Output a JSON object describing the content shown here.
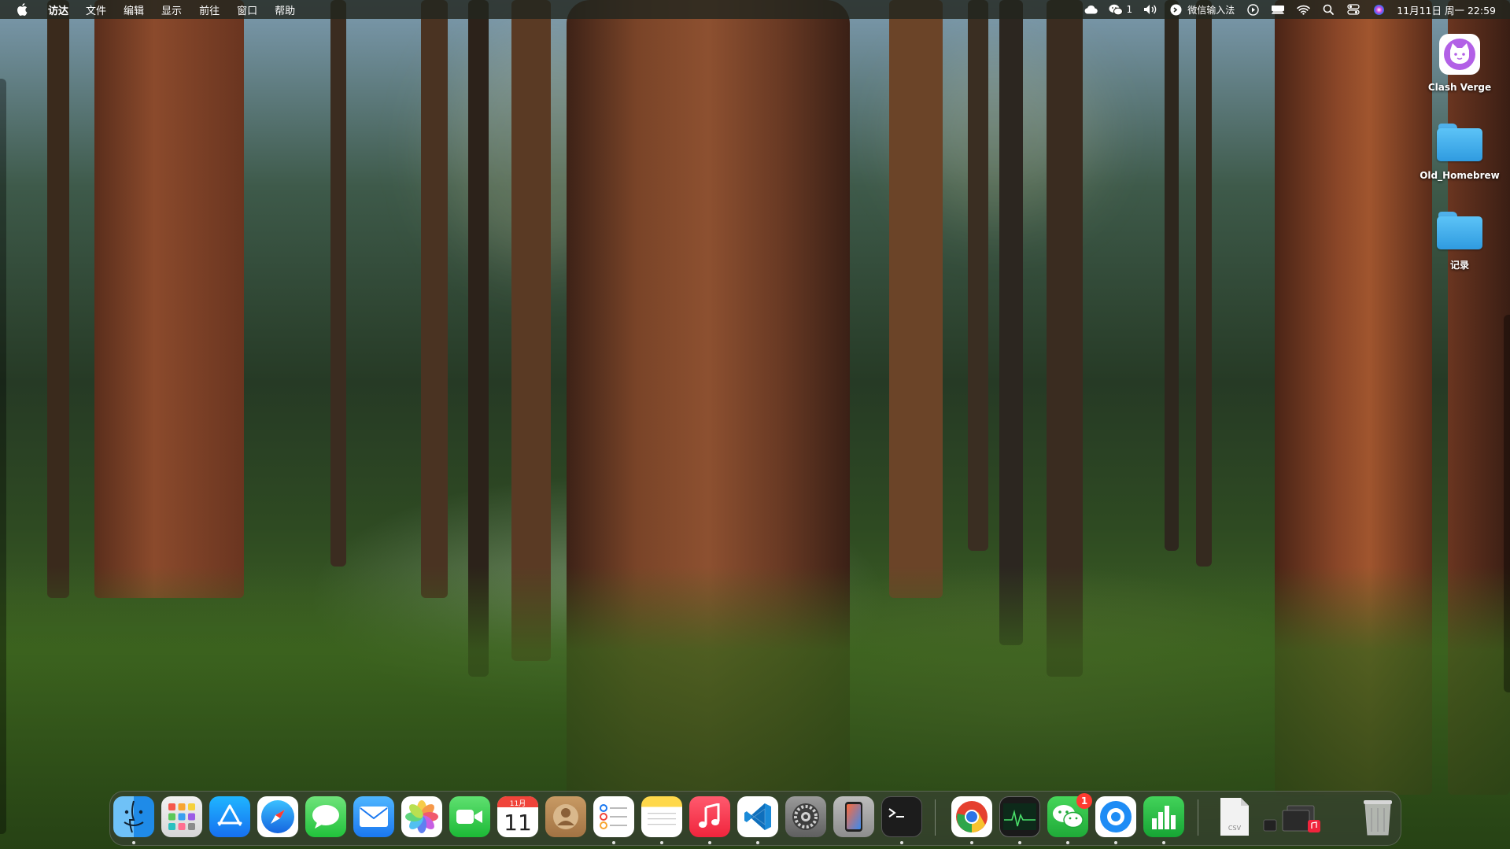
{
  "menubar": {
    "apple_icon": "apple-icon",
    "app_name": "访达",
    "items": [
      "文件",
      "编辑",
      "显示",
      "前往",
      "窗口",
      "帮助"
    ],
    "status": {
      "wechat_count": "1",
      "input_method": "微信输入法",
      "clock": "11月11日 周一 22:59"
    }
  },
  "desktop": {
    "items": [
      {
        "label": "Clash Verge",
        "icon": "cat-app-icon"
      },
      {
        "label": "Old_Homebrew",
        "icon": "folder-icon"
      },
      {
        "label": "记录",
        "icon": "folder-icon"
      }
    ]
  },
  "dock": {
    "apps": [
      {
        "name": "Finder",
        "icon": "finder-icon"
      },
      {
        "name": "Launchpad",
        "icon": "launchpad-icon"
      },
      {
        "name": "App Store",
        "icon": "app-store-icon"
      },
      {
        "name": "Safari",
        "icon": "safari-icon"
      },
      {
        "name": "Messages",
        "icon": "messages-icon"
      },
      {
        "name": "Mail",
        "icon": "mail-icon"
      },
      {
        "name": "Photos",
        "icon": "photos-icon"
      },
      {
        "name": "FaceTime",
        "icon": "facetime-icon"
      },
      {
        "name": "Calendar",
        "icon": "calendar-icon"
      },
      {
        "name": "Contacts",
        "icon": "contacts-icon"
      },
      {
        "name": "Reminders",
        "icon": "reminders-icon"
      },
      {
        "name": "Notes",
        "icon": "notes-icon"
      },
      {
        "name": "Music",
        "icon": "music-icon"
      },
      {
        "name": "Visual Studio Code",
        "icon": "vscode-icon"
      },
      {
        "name": "System Settings",
        "icon": "settings-icon"
      },
      {
        "name": "iPhone Mirroring",
        "icon": "iphone-mirroring-icon"
      },
      {
        "name": "Terminal",
        "icon": "terminal-icon"
      },
      {
        "name": "Chrome",
        "icon": "chrome-icon"
      },
      {
        "name": "Activity Monitor",
        "icon": "activity-monitor-icon"
      },
      {
        "name": "WeChat",
        "icon": "wechat-icon"
      },
      {
        "name": "QQ",
        "icon": "qq-icon"
      },
      {
        "name": "Numbers",
        "icon": "numbers-icon"
      },
      {
        "name": "CSV File",
        "icon": "csv-file-icon"
      },
      {
        "name": "Downloads Stack",
        "icon": "stack-icon"
      },
      {
        "name": "Trash",
        "icon": "trash-icon"
      }
    ],
    "calendar": {
      "month": "11月",
      "day": "11"
    },
    "wechat_badge": "1",
    "csv_label": "CSV"
  }
}
